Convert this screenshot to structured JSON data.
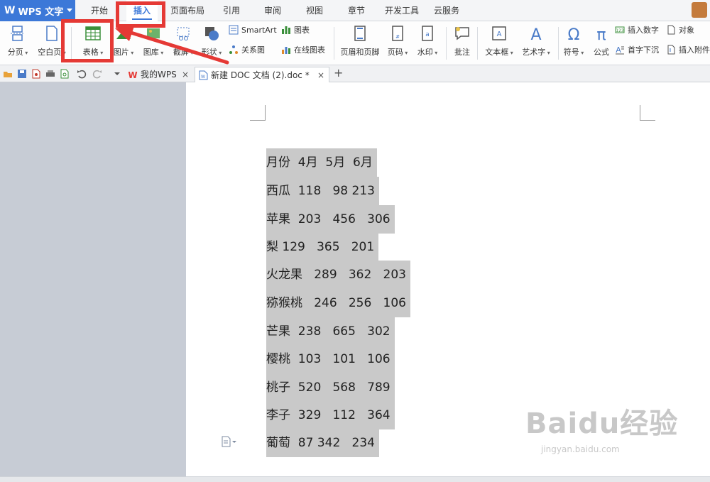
{
  "app": {
    "name": "WPS 文字",
    "logo": "W"
  },
  "menu_tabs": [
    "开始",
    "插入",
    "页面布局",
    "引用",
    "审阅",
    "视图",
    "章节",
    "开发工具",
    "云服务"
  ],
  "active_tab": "插入",
  "ribbon": {
    "page_break": "分页",
    "blank_page": "空白页",
    "table": "表格",
    "picture": "图片",
    "gallery": "图库",
    "screenshot": "截屏",
    "shape": "形状",
    "smartart": "SmartArt",
    "chart": "图表",
    "relation_chart": "关系图",
    "online_chart": "在线图表",
    "header_footer": "页眉和页脚",
    "page_number": "页码",
    "watermark": "水印",
    "comment": "批注",
    "textbox": "文本框",
    "wordart": "艺术字",
    "symbol": "符号",
    "formula": "公式",
    "insert_number": "插入数字",
    "object": "对象",
    "drop_cap": "首字下沉",
    "insert_attachment": "插入附件"
  },
  "doc_tabs": [
    {
      "label": "我的WPS",
      "close": "×"
    },
    {
      "label": "新建 DOC 文档 (2).doc *",
      "close": "×"
    }
  ],
  "document_lines": [
    "月份  4月  5月  6月",
    "西瓜  118   98 213",
    "苹果  203   456   306",
    "梨 129   365   201",
    "火龙果   289   362   203",
    "猕猴桃   246   256   106",
    "芒果  238   665   302",
    "樱桃  103   101   106",
    "桃子  520   568   789",
    "李子  329   112   364",
    "葡萄  87 342   234"
  ],
  "watermark": {
    "main": "Baidu经验",
    "sub": "jingyan.baidu.com"
  },
  "colors": {
    "accent": "#3c78d8",
    "highlight": "#e53935",
    "selection": "#c9c9c9"
  }
}
